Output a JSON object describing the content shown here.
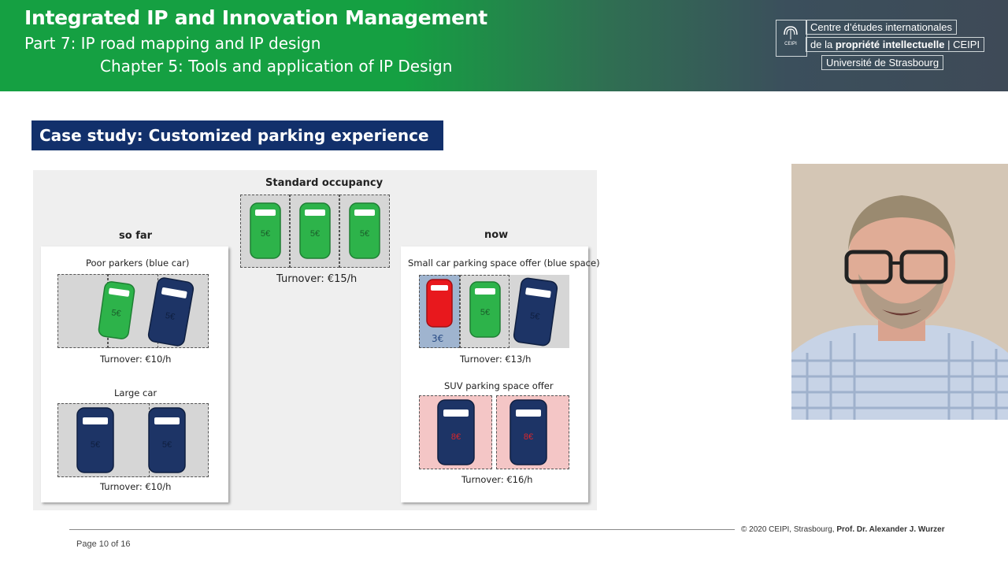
{
  "header": {
    "title": "Integrated IP and Innovation Management",
    "part": "Part 7: IP road mapping and IP design",
    "chapter": "Chapter 5: Tools and application of IP Design",
    "logo": {
      "line1": "Centre d’études internationales",
      "line2_prefix": "de la ",
      "line2_bold": "propriété intellectuelle",
      "line2_suffix": " | CEIPI",
      "line3": "Université de Strasbourg",
      "icon_text": "CEIPI"
    }
  },
  "slide": {
    "case_title": "Case study: Customized parking experience",
    "figure": {
      "standard_occupancy": "Standard occupancy",
      "standard_turnover": "Turnover: €15/h",
      "so_far": "so far",
      "now": "now",
      "poor_parkers": "Poor parkers (blue car)",
      "poor_turnover": "Turnover:  €10/h",
      "large_car": "Large car",
      "large_turnover": "Turnover:  €10/h",
      "small_offer": "Small car parking space offer (blue space)",
      "small_turnover": "Turnover:  €13/h",
      "suv_offer": "SUV parking space offer",
      "suv_turnover": "Turnover:  €16/h",
      "price_5": "5€",
      "price_3": "3€",
      "price_8": "8€"
    }
  },
  "footer": {
    "copyright_prefix": "© 2020 CEIPI, Strasbourg,",
    "copyright_author": "Prof. Dr. Alexander J. Wurzer",
    "page": "Page 10 of  16"
  },
  "colors": {
    "header_green": "#15a042",
    "header_dark": "#3e4a57",
    "case_title_bg": "#12306b",
    "car_green": "#2db34a",
    "car_blue": "#1d3466",
    "car_red": "#e8181d",
    "slot_blue": "#9fb4cf",
    "slot_pink": "#f4c6c6"
  },
  "icons": {
    "logo": "ceipi-logo-icon",
    "car": "car-top-view-icon"
  }
}
